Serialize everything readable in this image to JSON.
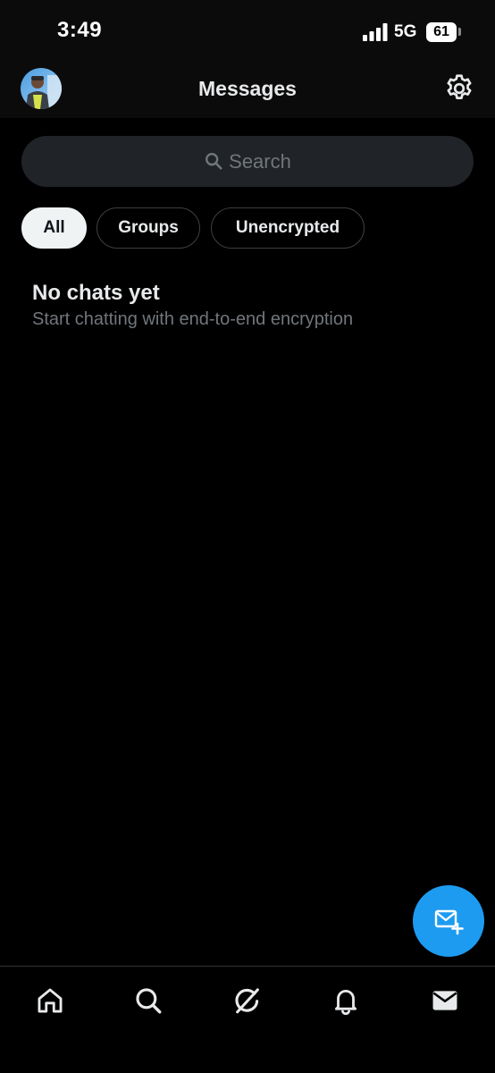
{
  "status_bar": {
    "time": "3:49",
    "network": "5G",
    "battery": "61"
  },
  "header": {
    "title": "Messages"
  },
  "search": {
    "placeholder": "Search"
  },
  "filters": [
    {
      "label": "All",
      "active": true
    },
    {
      "label": "Groups",
      "active": false
    },
    {
      "label": "Unencrypted",
      "active": false
    }
  ],
  "empty_state": {
    "title": "No chats yet",
    "subtitle": "Start chatting with end-to-end encryption"
  },
  "bottom_nav": [
    {
      "icon": "home-icon"
    },
    {
      "icon": "search-icon"
    },
    {
      "icon": "grok-icon"
    },
    {
      "icon": "bell-icon"
    },
    {
      "icon": "mail-icon",
      "active": true
    }
  ],
  "colors": {
    "background": "#000000",
    "accent": "#1d9bf0",
    "text_primary": "#e7e9ea",
    "text_secondary": "#71767b",
    "search_bg": "#202327"
  }
}
